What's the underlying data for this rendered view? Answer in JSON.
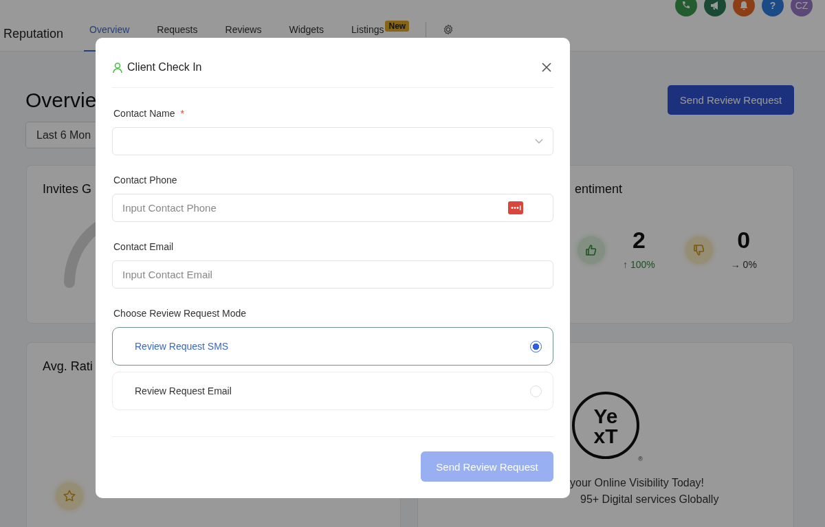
{
  "header": {
    "title": "Reputation",
    "tabs": [
      {
        "label": "Overview",
        "selected": true
      },
      {
        "label": "Requests",
        "selected": false
      },
      {
        "label": "Reviews",
        "selected": false
      },
      {
        "label": "Widgets",
        "selected": false
      },
      {
        "label": "Listings",
        "selected": false,
        "badge": "New"
      }
    ],
    "help_label": "?",
    "avatar": "CZ"
  },
  "page": {
    "heading": "Overvie",
    "action_button": "Send Review Request",
    "date_range": "Last 6 Mon"
  },
  "cards": {
    "invites_title": "Invites G",
    "sentiment": {
      "title": "entiment",
      "stats": [
        {
          "kind": "positive",
          "count": "2",
          "change": "↑ 100%"
        },
        {
          "kind": "negative",
          "count": "0",
          "change": "→ 0%"
        }
      ]
    },
    "rating_title": "Avg. Rati",
    "listings": {
      "logo_top": "Ye",
      "logo_bottom": "xT",
      "registered_mark": "®",
      "line_1": "your Online Visibility Today!",
      "line_2": "95+ Digital services Globally"
    }
  },
  "modal": {
    "title": "Client Check In",
    "fields": [
      {
        "kind": "select",
        "label": "Contact Name",
        "required_mark": "*"
      },
      {
        "kind": "text",
        "label": "Contact Phone",
        "placeholder": "Input Contact Phone",
        "autofill_icon": true
      },
      {
        "kind": "text",
        "label": "Contact Email",
        "placeholder": "Input Contact Email"
      }
    ],
    "mode_label": "Choose Review Request Mode",
    "modes": [
      {
        "label": "Review Request SMS",
        "selected": true
      },
      {
        "label": "Review Request Email",
        "selected": false
      }
    ],
    "submit": {
      "label": "Send Review Request",
      "disabled": true
    }
  }
}
